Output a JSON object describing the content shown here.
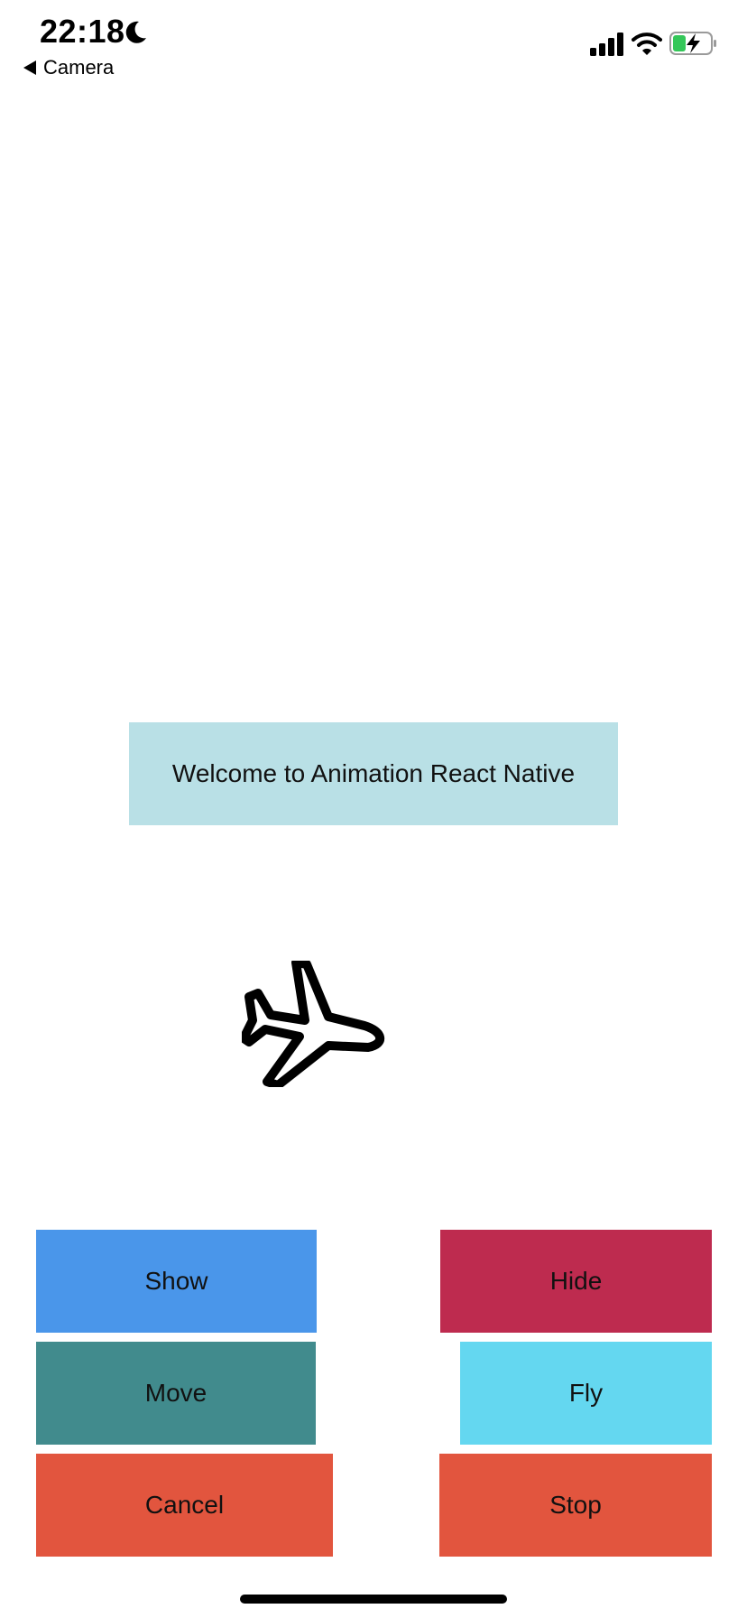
{
  "status_bar": {
    "time": "22:18",
    "back_label": "Camera",
    "moon_icon": "moon-icon",
    "signal_icon": "cellular-signal-icon",
    "wifi_icon": "wifi-icon",
    "battery_icon": "battery-charging-icon"
  },
  "main": {
    "welcome_text": "Welcome to Animation React Native",
    "welcome_color": "#b9e0e6",
    "airplane_icon": "airplane-icon"
  },
  "buttons": {
    "show": {
      "label": "Show",
      "color": "#4a96ea"
    },
    "hide": {
      "label": "Hide",
      "color": "#be2b4f"
    },
    "move": {
      "label": "Move",
      "color": "#418b8d"
    },
    "fly": {
      "label": "Fly",
      "color": "#64d7f0"
    },
    "cancel": {
      "label": "Cancel",
      "color": "#e2553e"
    },
    "stop": {
      "label": "Stop",
      "color": "#e2553e"
    }
  }
}
